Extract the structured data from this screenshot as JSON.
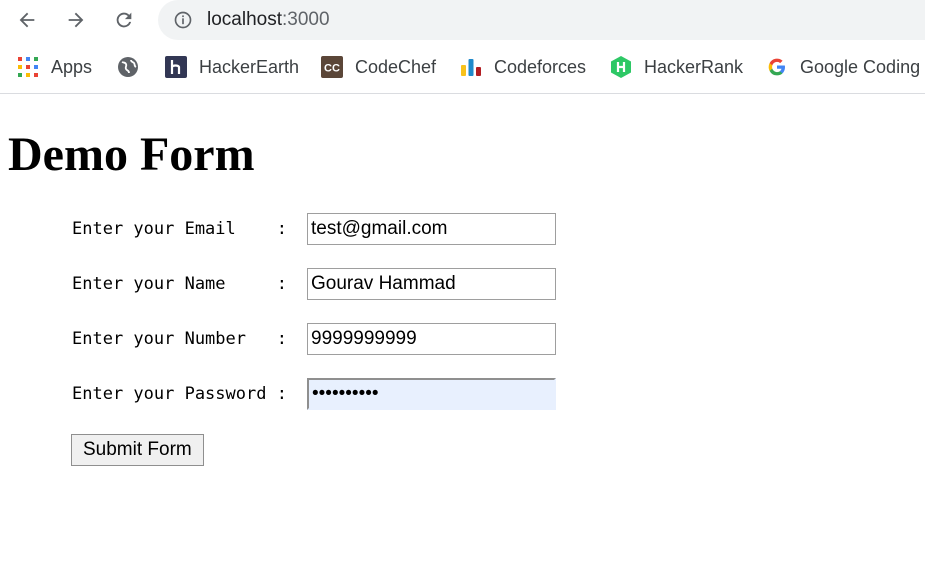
{
  "browser": {
    "url_host": "localhost",
    "url_port": ":3000",
    "bookmarks": [
      {
        "label": "Apps",
        "icon": "apps-grid-icon"
      },
      {
        "label": "",
        "icon": "globe-icon"
      },
      {
        "label": "HackerEarth",
        "icon": "hackerearth-icon"
      },
      {
        "label": "CodeChef",
        "icon": "codechef-icon"
      },
      {
        "label": "Codeforces",
        "icon": "codeforces-icon"
      },
      {
        "label": "HackerRank",
        "icon": "hackerrank-icon"
      },
      {
        "label": "Google Coding",
        "icon": "google-icon"
      }
    ]
  },
  "page": {
    "title": "Demo Form",
    "fields": [
      {
        "label": "Enter your Email    :",
        "value": "test@gmail.com"
      },
      {
        "label": "Enter your Name     :",
        "value": "Gourav Hammad"
      },
      {
        "label": "Enter your Number   :",
        "value": "9999999999"
      },
      {
        "label": "Enter your Password :",
        "value": "••••••••••"
      }
    ],
    "submit_label": "Submit Form"
  }
}
